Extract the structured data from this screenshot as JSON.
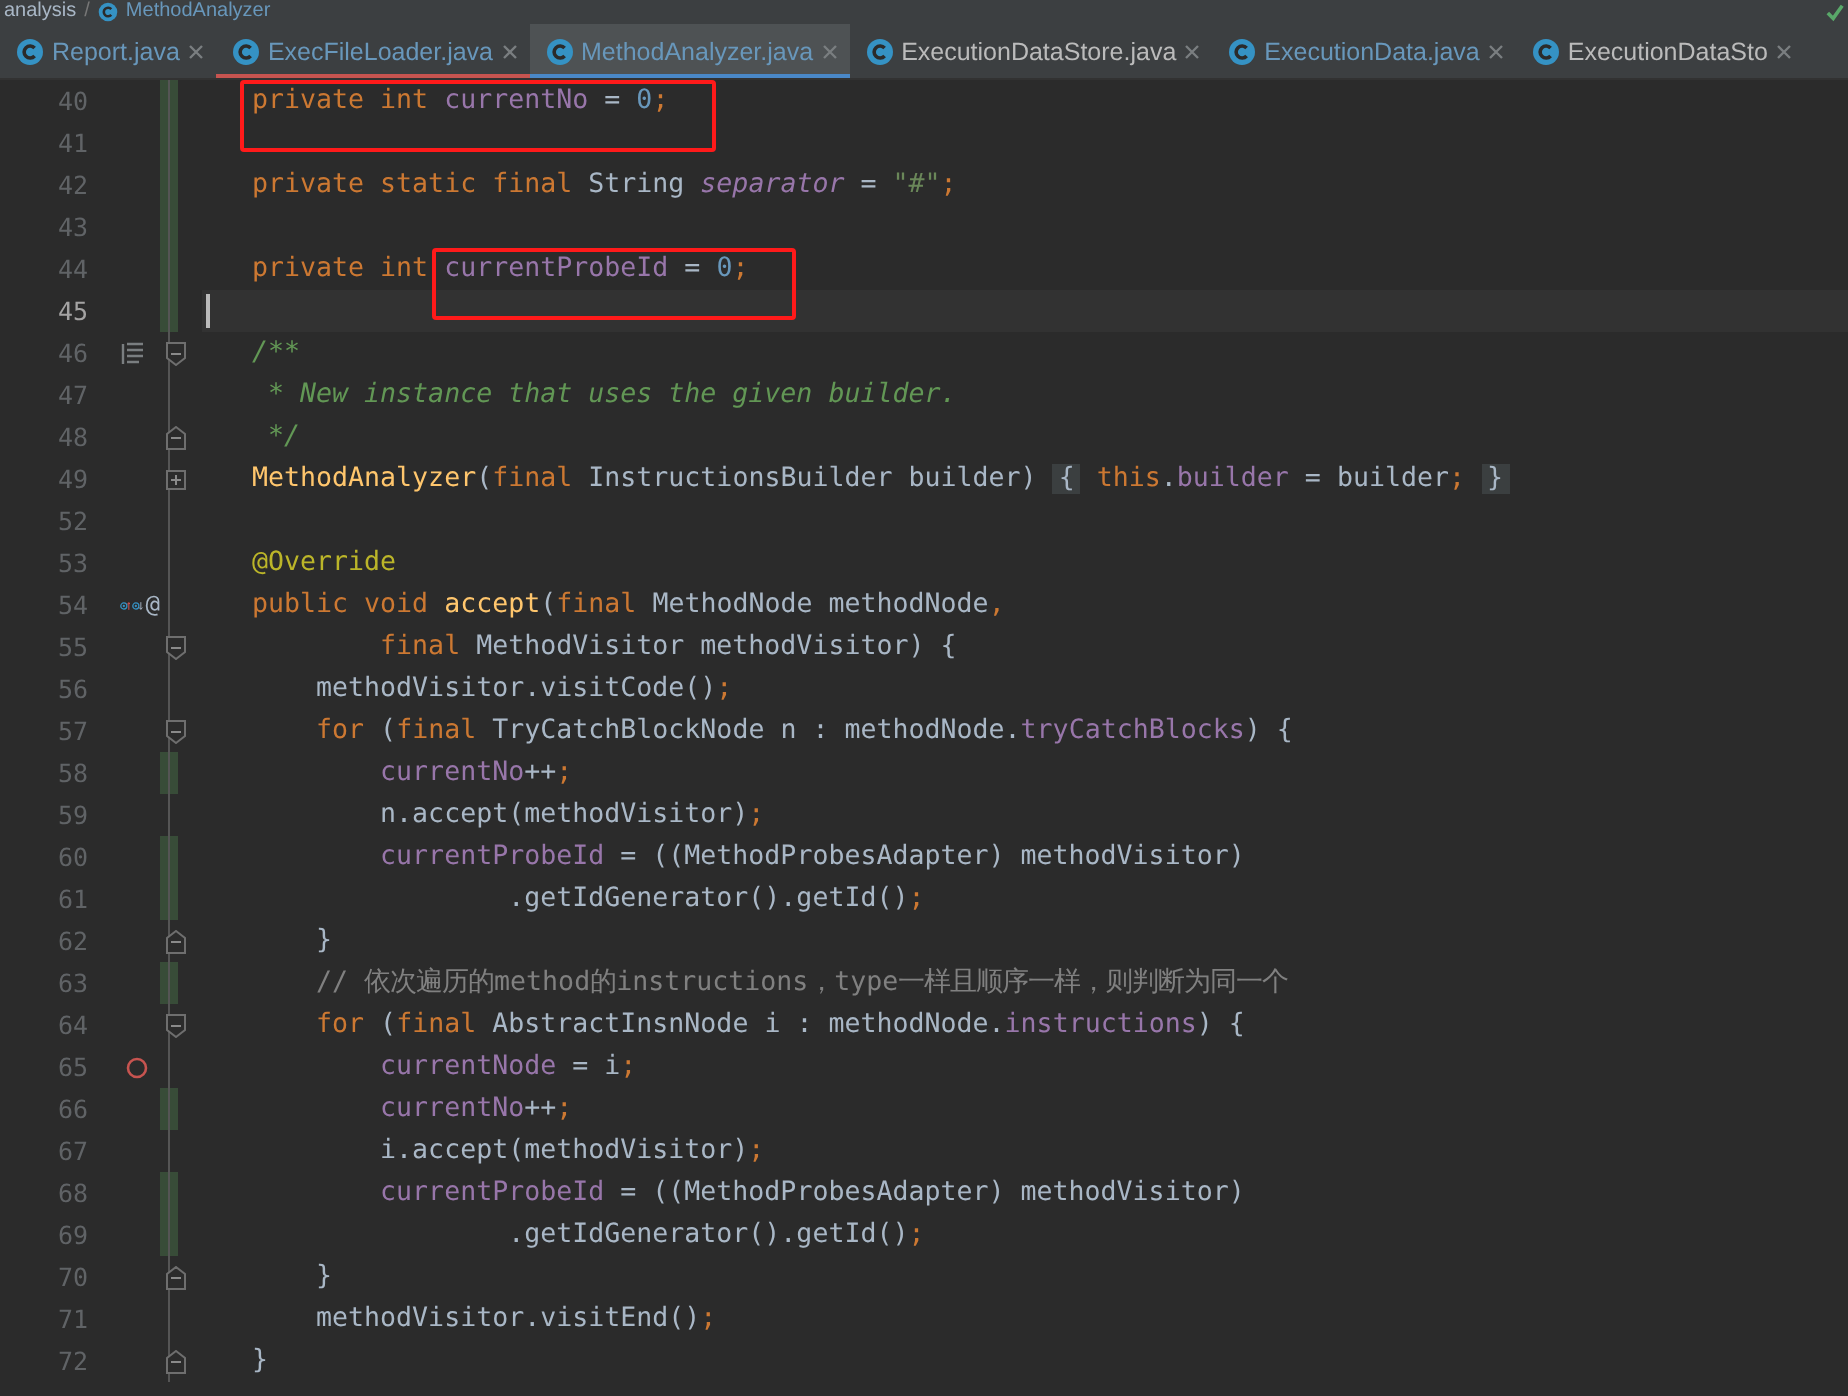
{
  "breadcrumb": [
    {
      "kind": "folder",
      "text": "analysis"
    },
    {
      "kind": "separator",
      "text": "/"
    },
    {
      "kind": "class",
      "text": "MethodAnalyzer"
    }
  ],
  "tabs": [
    {
      "label": "Report.java",
      "selected": false,
      "modified": true,
      "error": false
    },
    {
      "label": "ExecFileLoader.java",
      "selected": false,
      "modified": true,
      "error": true
    },
    {
      "label": "MethodAnalyzer.java",
      "selected": true,
      "modified": true,
      "error": false
    },
    {
      "label": "ExecutionDataStore.java",
      "selected": false,
      "modified": false,
      "error": false
    },
    {
      "label": "ExecutionData.java",
      "selected": false,
      "modified": true,
      "error": false
    },
    {
      "label": "ExecutionDataSto",
      "selected": false,
      "modified": false,
      "error": false
    }
  ],
  "lines": [
    {
      "number": "40",
      "changed": true,
      "tokens": [
        {
          "kind": "keyword",
          "text": "private int ",
          "boxed": true
        },
        {
          "kind": "field",
          "text": "currentNo",
          "boxed": true
        },
        {
          "kind": "plain",
          "text": " = ",
          "boxed": true
        },
        {
          "kind": "number",
          "text": "0",
          "boxed": true
        },
        {
          "kind": "punct",
          "text": ";",
          "boxed": true
        }
      ]
    },
    {
      "number": "41",
      "changed": true
    },
    {
      "number": "42",
      "changed": true,
      "tokens": [
        {
          "kind": "keyword",
          "text": "private static final "
        },
        {
          "kind": "plain",
          "text": "String "
        },
        {
          "kind": "static",
          "text": "separator"
        },
        {
          "kind": "plain",
          "text": " = "
        },
        {
          "kind": "string",
          "text": "\"#\""
        },
        {
          "kind": "punct",
          "text": ";"
        }
      ]
    },
    {
      "number": "43",
      "changed": true
    },
    {
      "number": "44",
      "changed": true,
      "tokens": [
        {
          "kind": "keyword",
          "text": "private int "
        },
        {
          "kind": "field",
          "text": "currentProbeId",
          "boxed": true
        },
        {
          "kind": "plain",
          "text": " = ",
          "boxed": true
        },
        {
          "kind": "number",
          "text": "0",
          "boxed": true
        },
        {
          "kind": "punct",
          "text": ";",
          "boxed": true
        }
      ]
    },
    {
      "number": "45",
      "changed": true,
      "current": true
    },
    {
      "number": "46",
      "fold_start": true,
      "markers": [
        {
          "kind": "doc"
        }
      ],
      "tokens": [
        {
          "kind": "doc",
          "text": "/**"
        }
      ]
    },
    {
      "number": "47",
      "tokens": [
        {
          "kind": "doc",
          "text": " * New instance that uses the given builder."
        }
      ]
    },
    {
      "number": "48",
      "fold_end": true,
      "tokens": [
        {
          "kind": "doc",
          "text": " */"
        }
      ]
    },
    {
      "number": "49",
      "folded": true,
      "tokens": [
        {
          "kind": "method",
          "text": "MethodAnalyzer"
        },
        {
          "kind": "plain",
          "text": "("
        },
        {
          "kind": "keyword",
          "text": "final "
        },
        {
          "kind": "plain",
          "text": "InstructionsBuilder builder) "
        },
        {
          "kind": "folded",
          "text": "{"
        },
        {
          "kind": "keyword",
          "text": " this"
        },
        {
          "kind": "plain",
          "text": "."
        },
        {
          "kind": "field",
          "text": "builder"
        },
        {
          "kind": "plain",
          "text": " = builder"
        },
        {
          "kind": "punct",
          "text": "; "
        },
        {
          "kind": "folded",
          "text": "}"
        }
      ]
    },
    {
      "number": "52"
    },
    {
      "number": "53",
      "tokens": [
        {
          "kind": "annotation",
          "text": "@Override"
        }
      ]
    },
    {
      "number": "54",
      "markers": [
        {
          "kind": "override-up"
        },
        {
          "kind": "override-down"
        },
        {
          "kind": "at",
          "text": "@"
        }
      ],
      "tokens": [
        {
          "kind": "keyword",
          "text": "public void "
        },
        {
          "kind": "method",
          "text": "accept"
        },
        {
          "kind": "plain",
          "text": "("
        },
        {
          "kind": "keyword",
          "text": "final "
        },
        {
          "kind": "plain",
          "text": "MethodNode methodNode"
        },
        {
          "kind": "punct",
          "text": ","
        }
      ]
    },
    {
      "number": "55",
      "fold_start": true,
      "tokens": [
        {
          "kind": "keyword",
          "text": "        final "
        },
        {
          "kind": "plain",
          "text": "MethodVisitor methodVisitor) {"
        }
      ]
    },
    {
      "number": "56",
      "tokens": [
        {
          "kind": "plain",
          "text": "    methodVisitor.visitCode()"
        },
        {
          "kind": "punct",
          "text": ";"
        }
      ]
    },
    {
      "number": "57",
      "fold_start": true,
      "tokens": [
        {
          "kind": "keyword",
          "text": "    for "
        },
        {
          "kind": "plain",
          "text": "("
        },
        {
          "kind": "keyword",
          "text": "final "
        },
        {
          "kind": "plain",
          "text": "TryCatchBlockNode n : methodNode."
        },
        {
          "kind": "field",
          "text": "tryCatchBlocks"
        },
        {
          "kind": "plain",
          "text": ") {"
        }
      ]
    },
    {
      "number": "58",
      "changed": true,
      "tokens": [
        {
          "kind": "field",
          "text": "        currentNo"
        },
        {
          "kind": "plain",
          "text": "++"
        },
        {
          "kind": "punct",
          "text": ";"
        }
      ]
    },
    {
      "number": "59",
      "tokens": [
        {
          "kind": "plain",
          "text": "        n.accept(methodVisitor)"
        },
        {
          "kind": "punct",
          "text": ";"
        }
      ]
    },
    {
      "number": "60",
      "changed": true,
      "tokens": [
        {
          "kind": "field",
          "text": "        currentProbeId"
        },
        {
          "kind": "plain",
          "text": " = ((MethodProbesAdapter) methodVisitor)"
        }
      ]
    },
    {
      "number": "61",
      "changed": true,
      "tokens": [
        {
          "kind": "plain",
          "text": "                .getIdGenerator().getId()"
        },
        {
          "kind": "punct",
          "text": ";"
        }
      ]
    },
    {
      "number": "62",
      "fold_end": true,
      "tokens": [
        {
          "kind": "plain",
          "text": "    }"
        }
      ]
    },
    {
      "number": "63",
      "changed": true,
      "tokens": [
        {
          "kind": "comment",
          "text": "    // 依次遍历的method的instructions，type一样且顺序一样，则判断为同一个"
        }
      ]
    },
    {
      "number": "64",
      "fold_start": true,
      "tokens": [
        {
          "kind": "keyword",
          "text": "    for "
        },
        {
          "kind": "plain",
          "text": "("
        },
        {
          "kind": "keyword",
          "text": "final "
        },
        {
          "kind": "plain",
          "text": "AbstractInsnNode i : methodNode."
        },
        {
          "kind": "field",
          "text": "instructions"
        },
        {
          "kind": "plain",
          "text": ") {"
        }
      ]
    },
    {
      "number": "65",
      "markers": [
        {
          "kind": "breakpoint"
        }
      ],
      "tokens": [
        {
          "kind": "field",
          "text": "        currentNode"
        },
        {
          "kind": "plain",
          "text": " = i"
        },
        {
          "kind": "punct",
          "text": ";"
        }
      ]
    },
    {
      "number": "66",
      "changed": true,
      "tokens": [
        {
          "kind": "field",
          "text": "        currentNo"
        },
        {
          "kind": "plain",
          "text": "++"
        },
        {
          "kind": "punct",
          "text": ";"
        }
      ]
    },
    {
      "number": "67",
      "tokens": [
        {
          "kind": "plain",
          "text": "        i.accept(methodVisitor)"
        },
        {
          "kind": "punct",
          "text": ";"
        }
      ]
    },
    {
      "number": "68",
      "changed": true,
      "tokens": [
        {
          "kind": "field",
          "text": "        currentProbeId"
        },
        {
          "kind": "plain",
          "text": " = ((MethodProbesAdapter) methodVisitor)"
        }
      ]
    },
    {
      "number": "69",
      "changed": true,
      "tokens": [
        {
          "kind": "plain",
          "text": "                .getIdGenerator().getId()"
        },
        {
          "kind": "punct",
          "text": ";"
        }
      ]
    },
    {
      "number": "70",
      "fold_end": true,
      "tokens": [
        {
          "kind": "plain",
          "text": "    }"
        }
      ]
    },
    {
      "number": "71",
      "tokens": [
        {
          "kind": "plain",
          "text": "    methodVisitor.visitEnd()"
        },
        {
          "kind": "punct",
          "text": ";"
        }
      ]
    },
    {
      "number": "72",
      "fold_end": true,
      "tokens": [
        {
          "kind": "plain",
          "text": "}"
        }
      ]
    }
  ]
}
